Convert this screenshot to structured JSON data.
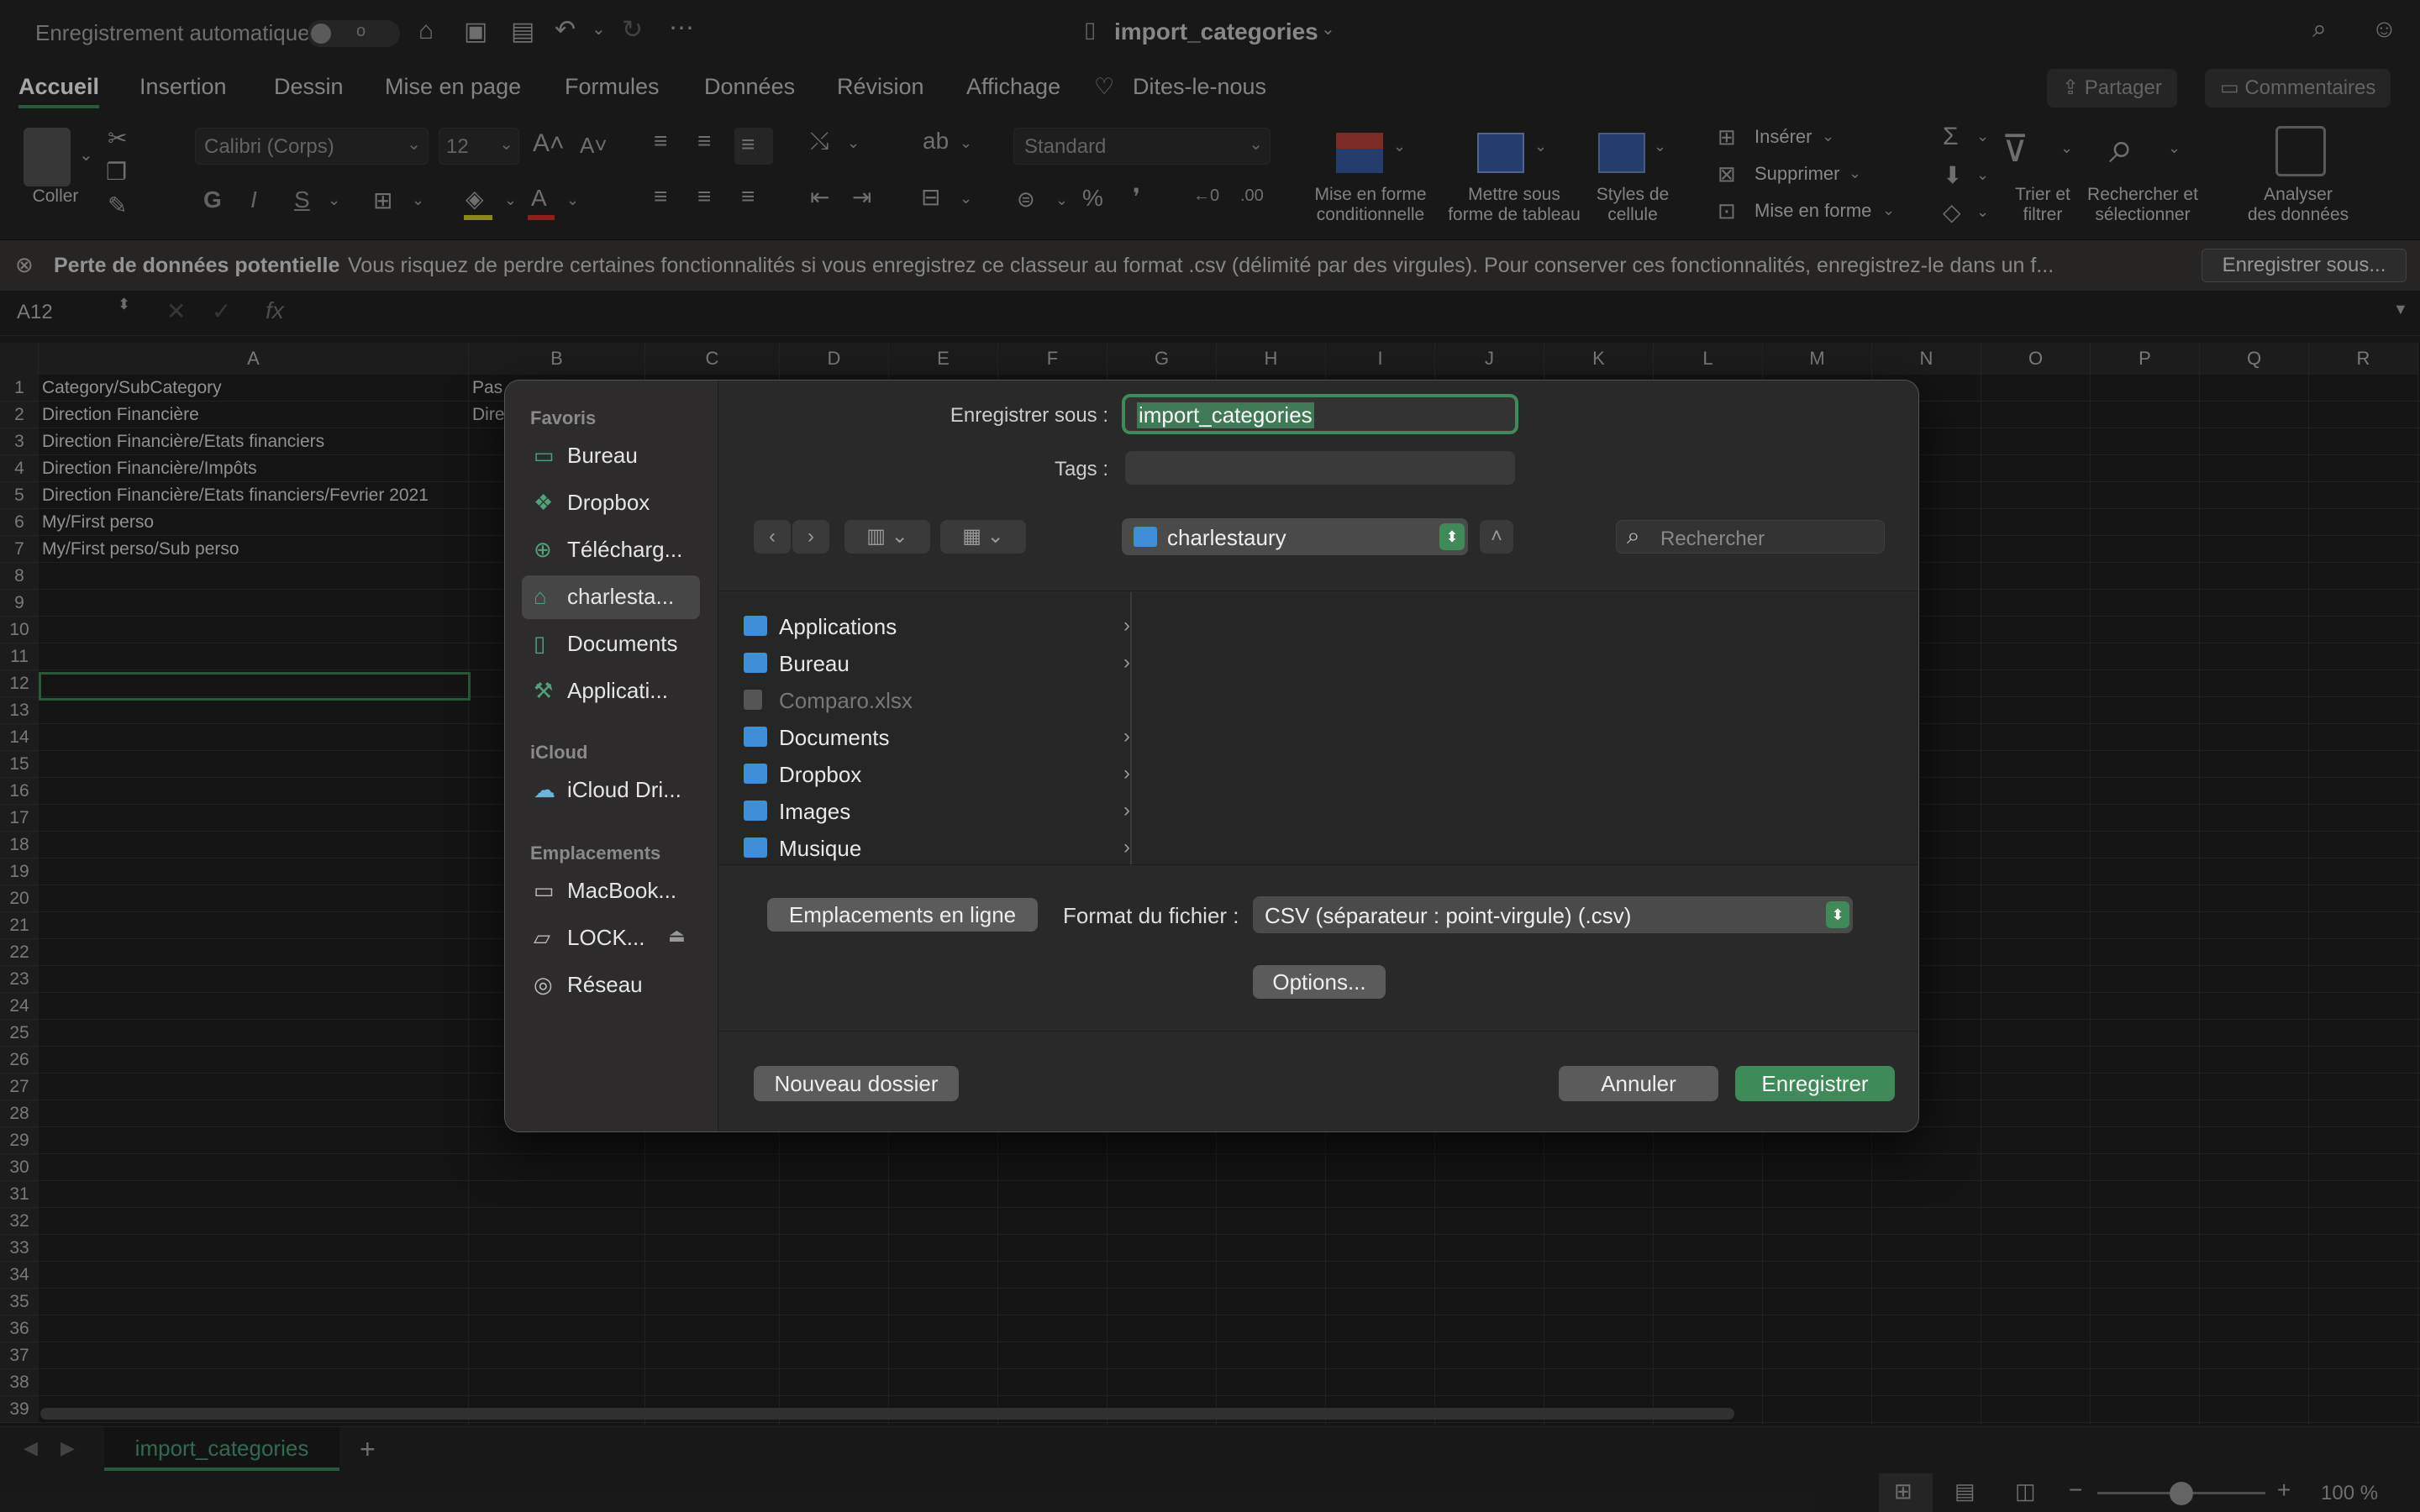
{
  "titlebar": {
    "autosave_label": "Enregistrement automatique",
    "toggle_state": "o",
    "doc_title": "import_categories"
  },
  "tabs": [
    "Accueil",
    "Insertion",
    "Dessin",
    "Mise en page",
    "Formules",
    "Données",
    "Révision",
    "Affichage"
  ],
  "tellme": "Dites-le-nous",
  "share_label": "Partager",
  "comments_label": "Commentaires",
  "ribbon": {
    "paste_label": "Coller",
    "font_name": "Calibri (Corps)",
    "font_size": "12",
    "bold": "G",
    "italic": "I",
    "underline": "S",
    "number_format": "Standard",
    "cond_format_1": "Mise en forme",
    "cond_format_2": "conditionnelle",
    "table_format_1": "Mettre sous",
    "table_format_2": "forme de tableau",
    "cell_styles_1": "Styles de",
    "cell_styles_2": "cellule",
    "insert": "Insérer",
    "delete": "Supprimer",
    "format": "Mise en forme",
    "sort_1": "Trier et",
    "sort_2": "filtrer",
    "find_1": "Rechercher et",
    "find_2": "sélectionner",
    "analyze_1": "Analyser",
    "analyze_2": "des données"
  },
  "warning": {
    "title": "Perte de données potentielle",
    "message": "Vous risquez de perdre certaines fonctionnalités si vous enregistrez ce classeur au format .csv (délimité par des virgules). Pour conserver ces fonctionnalités, enregistrez-le dans un f...",
    "button": "Enregistrer sous..."
  },
  "formula": {
    "namebox": "A12",
    "fx": "fx"
  },
  "columns": [
    "A",
    "B",
    "C",
    "D",
    "E",
    "F",
    "G",
    "H",
    "I",
    "J",
    "K",
    "L",
    "M",
    "N",
    "O",
    "P",
    "Q",
    "R"
  ],
  "rows": [
    "1",
    "2",
    "3",
    "4",
    "5",
    "6",
    "7",
    "8",
    "9",
    "10",
    "11",
    "12",
    "13",
    "14",
    "15",
    "16",
    "17",
    "18",
    "19",
    "20",
    "21",
    "22",
    "23",
    "24",
    "25",
    "26",
    "27",
    "28",
    "29",
    "30",
    "31",
    "32",
    "33",
    "34",
    "35",
    "36",
    "37",
    "38",
    "39"
  ],
  "cells": {
    "a1": "Category/SubCategory",
    "a2": "Direction Financière",
    "a3": "Direction Financière/Etats financiers",
    "a4": "Direction Financière/Impôts",
    "a5": "Direction Financière/Etats financiers/Fevrier 2021",
    "a6": "My/First perso",
    "a7": "My/First perso/Sub perso",
    "b1": "Pas",
    "b2": "Dire"
  },
  "sheet_tab": "import_categories",
  "zoom": "100 %",
  "dialog": {
    "favorites_header": "Favoris",
    "favorites": [
      "Bureau",
      "Dropbox",
      "Télécharg...",
      "charlesta...",
      "Documents",
      "Applicati..."
    ],
    "icloud_header": "iCloud",
    "icloud_item": "iCloud Dri...",
    "locations_header": "Emplacements",
    "locations": [
      "MacBook...",
      "LOCK...",
      "Réseau"
    ],
    "save_as_label": "Enregistrer sous :",
    "save_as_value": "import_categories",
    "tags_label": "Tags :",
    "location_value": "charlestaury",
    "search_placeholder": "Rechercher",
    "files": [
      {
        "name": "Applications",
        "chev": "›"
      },
      {
        "name": "Bureau",
        "chev": "›"
      },
      {
        "name": "Comparo.xlsx",
        "chev": ""
      },
      {
        "name": "Documents",
        "chev": "›"
      },
      {
        "name": "Dropbox",
        "chev": "›"
      },
      {
        "name": "Images",
        "chev": "›"
      },
      {
        "name": "Musique",
        "chev": "›"
      }
    ],
    "online_locations": "Emplacements en ligne",
    "format_label": "Format du fichier :",
    "format_value": "CSV (séparateur : point-virgule) (.csv)",
    "options": "Options...",
    "new_folder": "Nouveau dossier",
    "cancel": "Annuler",
    "save": "Enregistrer"
  },
  "colors": {
    "accent_green": "#3e8a59",
    "folder_blue": "#3e8fd6",
    "side_icon_green": "#4fa37a"
  }
}
